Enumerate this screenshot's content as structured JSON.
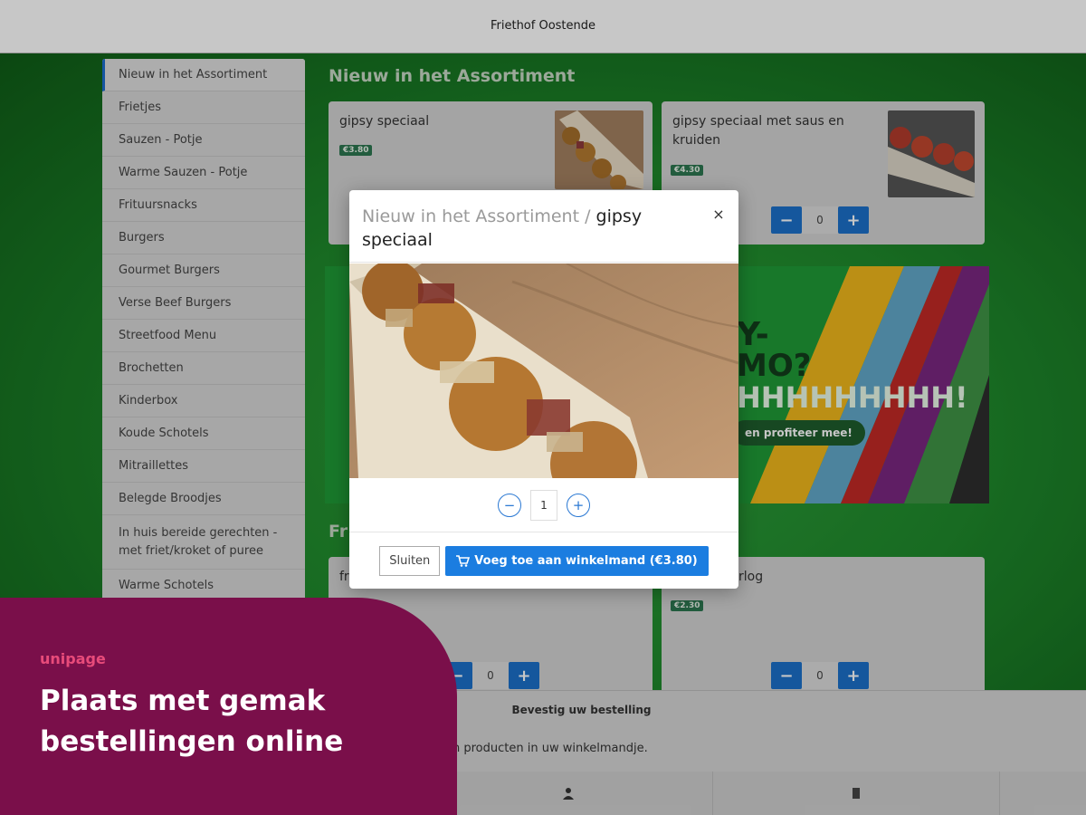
{
  "app": {
    "title": "Friethof Oostende"
  },
  "sidebar": {
    "items": [
      {
        "label": "Nieuw in het Assortiment"
      },
      {
        "label": "Frietjes"
      },
      {
        "label": "Sauzen - Potje"
      },
      {
        "label": "Warme Sauzen - Potje"
      },
      {
        "label": "Frituursnacks"
      },
      {
        "label": "Burgers"
      },
      {
        "label": "Gourmet Burgers"
      },
      {
        "label": "Verse Beef Burgers"
      },
      {
        "label": "Streetfood Menu"
      },
      {
        "label": "Brochetten"
      },
      {
        "label": "Kinderbox"
      },
      {
        "label": "Koude Schotels"
      },
      {
        "label": "Mitraillettes"
      },
      {
        "label": "Belegde Broodjes"
      },
      {
        "label": "In huis bereide gerechten - met friet/kroket of puree"
      },
      {
        "label": "Warme Schotels"
      }
    ]
  },
  "sections": {
    "new": {
      "title": "Nieuw in het Assortiment"
    },
    "fries": {
      "title_partial": "Fr"
    }
  },
  "products": [
    {
      "name": "gipsy speciaal",
      "price": "€3.80"
    },
    {
      "name": "gipsy speciaal met saus en kruiden",
      "price": "€4.30",
      "qty": "0"
    },
    {
      "name_partial": "fr",
      "qty": "0"
    },
    {
      "name_partial": "rlog",
      "price": "€2.30",
      "qty": "0"
    }
  ],
  "qty_buttons": {
    "minus": "−",
    "plus": "+"
  },
  "banner": {
    "line1": "Y-",
    "line2": "MO?",
    "line3": "HHHHHHHHH!",
    "cta": "en profiteer mee!"
  },
  "modal": {
    "breadcrumb": "Nieuw in het Assortiment /",
    "product": "gipsy speciaal",
    "close": "×",
    "quantity": "1",
    "close_label": "Sluiten",
    "add_label": "Voeg toe aan winkelmand (€3.80)"
  },
  "confirm": {
    "title": "Bevestig uw bestelling",
    "message": "n producten in uw winkelmandje."
  },
  "promo": {
    "logo": "unipage",
    "headline": "Plaats met gemak bestellingen online"
  },
  "colors": {
    "brand_green": "#1f8a2c",
    "accent_blue": "#1b7de0",
    "price_badge": "#2c7750",
    "promo_bg": "#7a0f4a"
  }
}
